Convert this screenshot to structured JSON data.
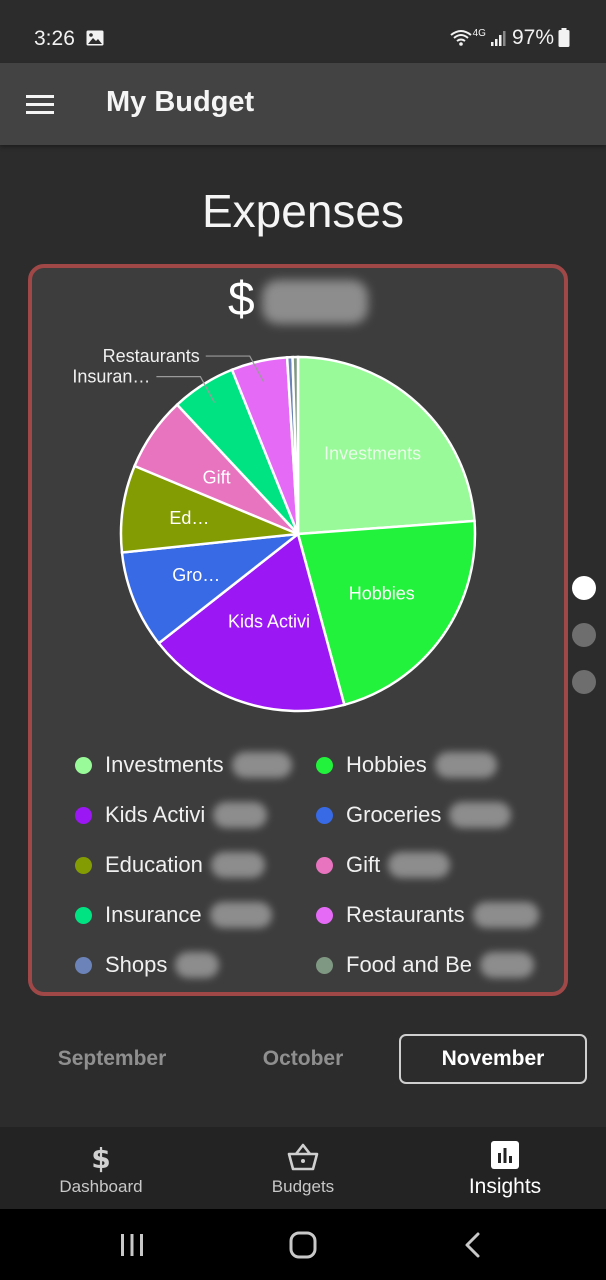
{
  "status_bar": {
    "time": "3:26",
    "battery": "97%",
    "network": "4G"
  },
  "app_bar": {
    "title": "My Budget",
    "menu_icon": "hamburger-menu-icon"
  },
  "page_title": "Expenses",
  "total": {
    "currency_symbol": "$"
  },
  "chart_data": {
    "type": "pie",
    "categories": [
      "Investments",
      "Hobbies",
      "Kids Activi",
      "Groceries",
      "Education",
      "Gift",
      "Insurance",
      "Restaurants",
      "Shops",
      "Food and Be"
    ],
    "slice_labels": [
      "Investments",
      "Hobbies",
      "Kids Activi",
      "Gro…",
      "Ed…",
      "Gift",
      "",
      "",
      "",
      ""
    ],
    "callout_labels": [
      {
        "category": "Insurance",
        "text": "Insuran…"
      },
      {
        "category": "Restaurants",
        "text": "Restaurants"
      }
    ],
    "values": [
      24.3,
      22.4,
      19.0,
      9.1,
      8.1,
      6.9,
      6.0,
      5.2,
      0.5,
      0.5
    ],
    "colors": [
      "#98fa98",
      "#22f23c",
      "#9b17f3",
      "#386ae5",
      "#849c03",
      "#e873bf",
      "#00e383",
      "#e56bf7",
      "#6b83b8",
      "#7f9883"
    ],
    "start_angle_deg": 0,
    "direction": "clockwise"
  },
  "legend": [
    {
      "label": "Investments",
      "color": "#98fa98"
    },
    {
      "label": "Hobbies",
      "color": "#22f23c"
    },
    {
      "label": "Kids Activi",
      "color": "#9b17f3"
    },
    {
      "label": "Groceries",
      "color": "#386ae5"
    },
    {
      "label": "Education",
      "color": "#849c03"
    },
    {
      "label": "Gift",
      "color": "#e873bf"
    },
    {
      "label": "Insurance",
      "color": "#00e383"
    },
    {
      "label": "Restaurants",
      "color": "#e56bf7"
    },
    {
      "label": "Shops",
      "color": "#6b83b8"
    },
    {
      "label": "Food and Be",
      "color": "#7f9883"
    }
  ],
  "pager": {
    "count": 3,
    "active_index": 0
  },
  "months": [
    {
      "label": "September",
      "selected": false
    },
    {
      "label": "October",
      "selected": false
    },
    {
      "label": "November",
      "selected": true
    }
  ],
  "bottom_nav": [
    {
      "label": "Dashboard",
      "icon": "dollar-icon",
      "active": false
    },
    {
      "label": "Budgets",
      "icon": "basket-icon",
      "active": false
    },
    {
      "label": "Insights",
      "icon": "bar-chart-icon",
      "active": true
    }
  ],
  "system_nav": {
    "recents_icon": "recents-icon",
    "home_icon": "home-icon",
    "back_icon": "back-icon"
  },
  "colors": {
    "background": "#2c2c2c",
    "app_bar": "#434343",
    "card_border": "#a04848",
    "card_background": "#3d3d3d"
  }
}
